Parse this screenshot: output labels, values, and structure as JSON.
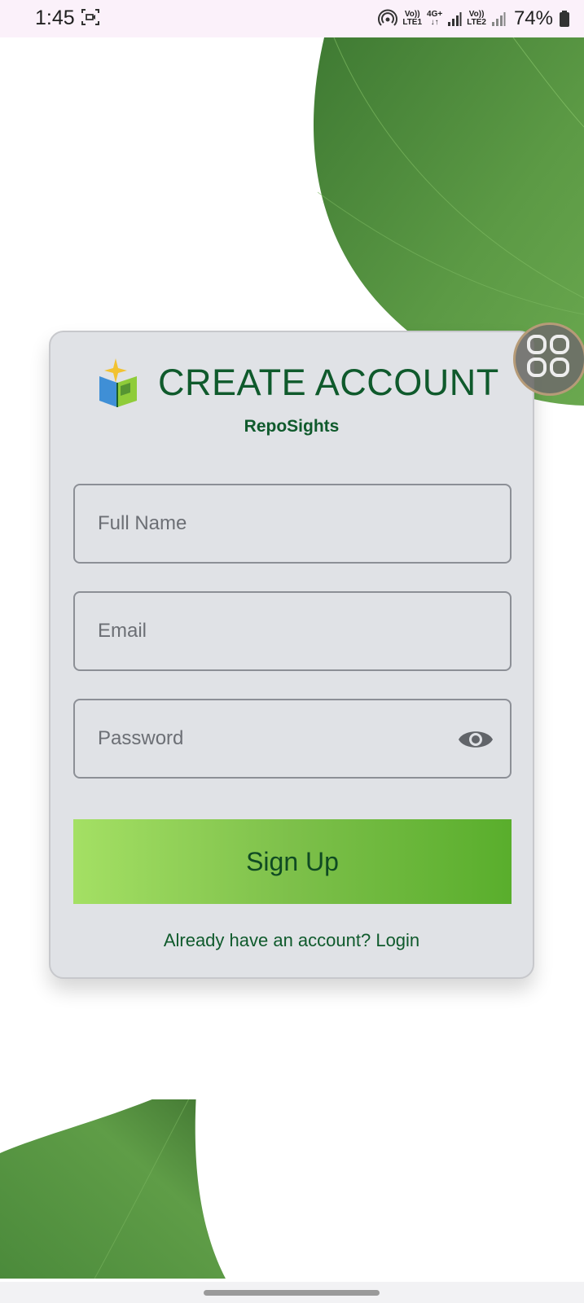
{
  "status_bar": {
    "time": "1:45",
    "sim1_top": "Vo))",
    "sim1_bottom": "LTE1",
    "net_top": "4G+",
    "net_bottom": "↓↑",
    "sim2_top": "Vo))",
    "sim2_bottom": "LTE2",
    "battery": "74%"
  },
  "card": {
    "title": "CREATE ACCOUNT",
    "subtitle": "RepoSights",
    "fields": {
      "full_name_placeholder": "Full Name",
      "email_placeholder": "Email",
      "password_placeholder": "Password"
    },
    "signup_label": "Sign Up",
    "login_prompt": "Already have an account? Login"
  },
  "colors": {
    "brand_green": "#0f5a2c",
    "card_bg": "#e0e2e6",
    "button_gradient_start": "#a4e064",
    "button_gradient_end": "#59ae2c",
    "leaf_green": "#4f8f3a"
  }
}
